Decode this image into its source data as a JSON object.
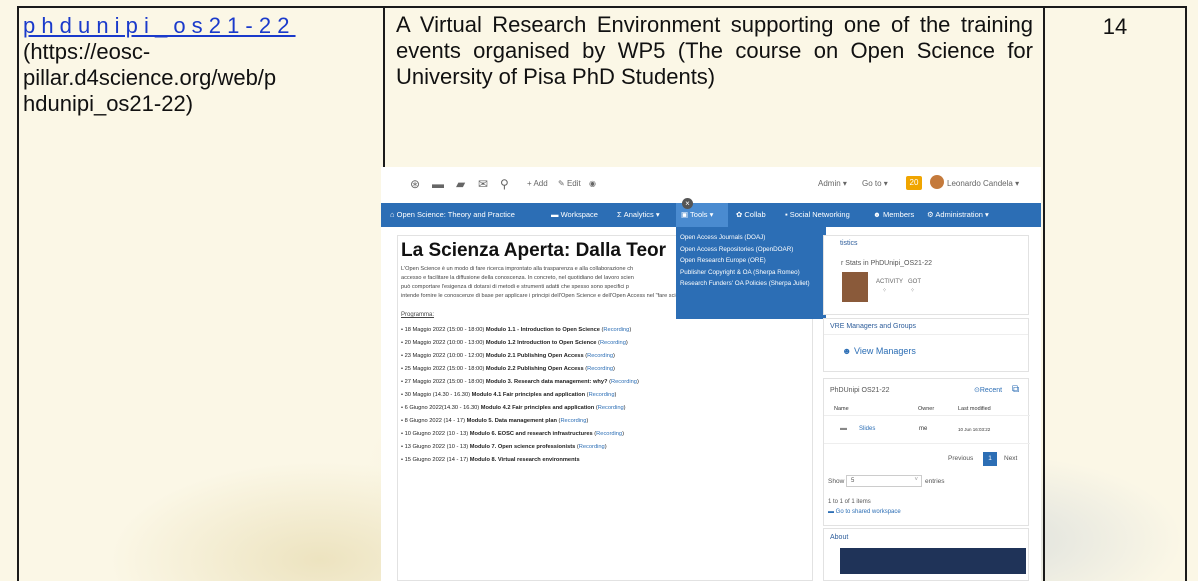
{
  "row": {
    "name_link": "phdunipi_os21-22",
    "url": "(https://eosc-pillar.d4science.org/web/phdunipi_os21-22)",
    "url_lines": [
      "(https://eosc-",
      "pillar.d4science.org/web/p",
      "hdunipi_os21-22)"
    ],
    "description": "A Virtual Research Environment supporting one of the training events organised by WP5 (The course on Open Science for University of Pisa PhD Students)",
    "count": "14"
  },
  "screenshot": {
    "topbar": {
      "add_label": "Add",
      "edit_label": "Edit",
      "admin_label": "Admin",
      "goto_label": "Go to",
      "notifications": "20",
      "user_name": "Leonardo Candela"
    },
    "nav": [
      {
        "label": "Open Science: Theory and Practice",
        "icon": "home-icon"
      },
      {
        "label": "Workspace",
        "icon": "folder-icon"
      },
      {
        "label": "Analytics",
        "icon": "sigma-icon"
      },
      {
        "label": "Tools",
        "icon": "briefcase-icon"
      },
      {
        "label": "Collab",
        "icon": "collab-icon"
      },
      {
        "label": "Social Networking",
        "icon": "chat-icon"
      },
      {
        "label": "Members",
        "icon": "users-icon"
      },
      {
        "label": "Administration",
        "icon": "gear-icon"
      }
    ],
    "tools_menu": [
      "Open Access Journals (DOAJ)",
      "Open Access Repositories (OpenDOAR)",
      "Open Research Europe (ORE)",
      "Publisher Copyright & OA (Sherpa Romeo)",
      "Research Funders' OA Policies (Sherpa Juliet)"
    ],
    "main": {
      "title": "La Scienza Aperta: Dalla Teor",
      "intro_lines": [
        "L'Open Science è un modo di fare ricerca improntato alla trasparenza e alla collaborazione ch",
        "accesso e facilitare la diffusione della conoscenza. In concreto, nel quotidiano del lavoro scien",
        "può comportare l'esigenza di dotarsi di metodi e strumenti adatti che spesso sono specifici p",
        "intende fornire le conoscenze di base per applicare i principi dell'Open Science e dell'Open Access nel \"fare scienza\"."
      ],
      "programme_label": "Programma:",
      "modules": [
        {
          "date": "18 Maggio 2022 (15:00 - 18:00)",
          "title": "Modulo 1.1 - Introduction to Open Science",
          "rec": "Recording"
        },
        {
          "date": "20 Maggio 2022 (10:00 - 13:00)",
          "title": "Modulo 1.2 Introduction to Open Science",
          "rec": "Recording"
        },
        {
          "date": "23 Maggio 2022 (10:00 - 12:00)",
          "title": "Modulo 2.1 Publishing Open Access",
          "rec": "Recording"
        },
        {
          "date": "25 Maggio 2022 (15:00 - 18:00)",
          "title": "Modulo 2.2 Publishing Open Access",
          "rec": "Recording"
        },
        {
          "date": "27 Maggio 2022 (15:00 - 18:00)",
          "title": "Modulo 3. Research data management: why?",
          "rec": "Recording"
        },
        {
          "date": "30 Maggio (14.30 - 16.30)",
          "title": "Modulo 4.1 Fair principles and application",
          "rec": "Recording"
        },
        {
          "date": "6 Giugno 2022(14.30 - 16.30)",
          "title": "Modulo 4.2 Fair principles and application",
          "rec": "Recording"
        },
        {
          "date": "8 Giugno 2022 (14 - 17)",
          "title": "Modulo 5. Data management plan",
          "rec": "Recording"
        },
        {
          "date": "10 Giugno 2022 (10 - 13)",
          "title": "Modulo 6. EOSC and research infrastructures",
          "rec": "Recording"
        },
        {
          "date": "13 Giugno 2022 (10 - 13)",
          "title": "Modulo 7. Open science professionists",
          "rec": "Recording"
        },
        {
          "date": "15 Giugno 2022 (14 - 17)",
          "title": "Modulo 8. Virtual research environments",
          "rec": ""
        }
      ]
    },
    "stats": {
      "title": "tistics",
      "subtitle": "r Stats in PhDUnipi_OS21-22",
      "activity_label": "ACTIVITY",
      "got_label": "GOT"
    },
    "managers": {
      "title": "VRE Managers and Groups",
      "link": "View Managers"
    },
    "workspace": {
      "title": "PhDUnipi OS21-22",
      "recent_label": "Recent",
      "columns": [
        "Name",
        "Owner",
        "Last modified"
      ],
      "rows": [
        {
          "name": "Slides",
          "owner": "me",
          "modified": "10 Jun 16:03:22"
        }
      ],
      "prev_label": "Previous",
      "page": "1",
      "next_label": "Next",
      "show_label": "Show",
      "show_value": "5",
      "entries_label": "entries",
      "info": "1 to 1 of 1 items",
      "shared_link": "Go to shared workspace"
    },
    "about": {
      "title": "About"
    }
  }
}
